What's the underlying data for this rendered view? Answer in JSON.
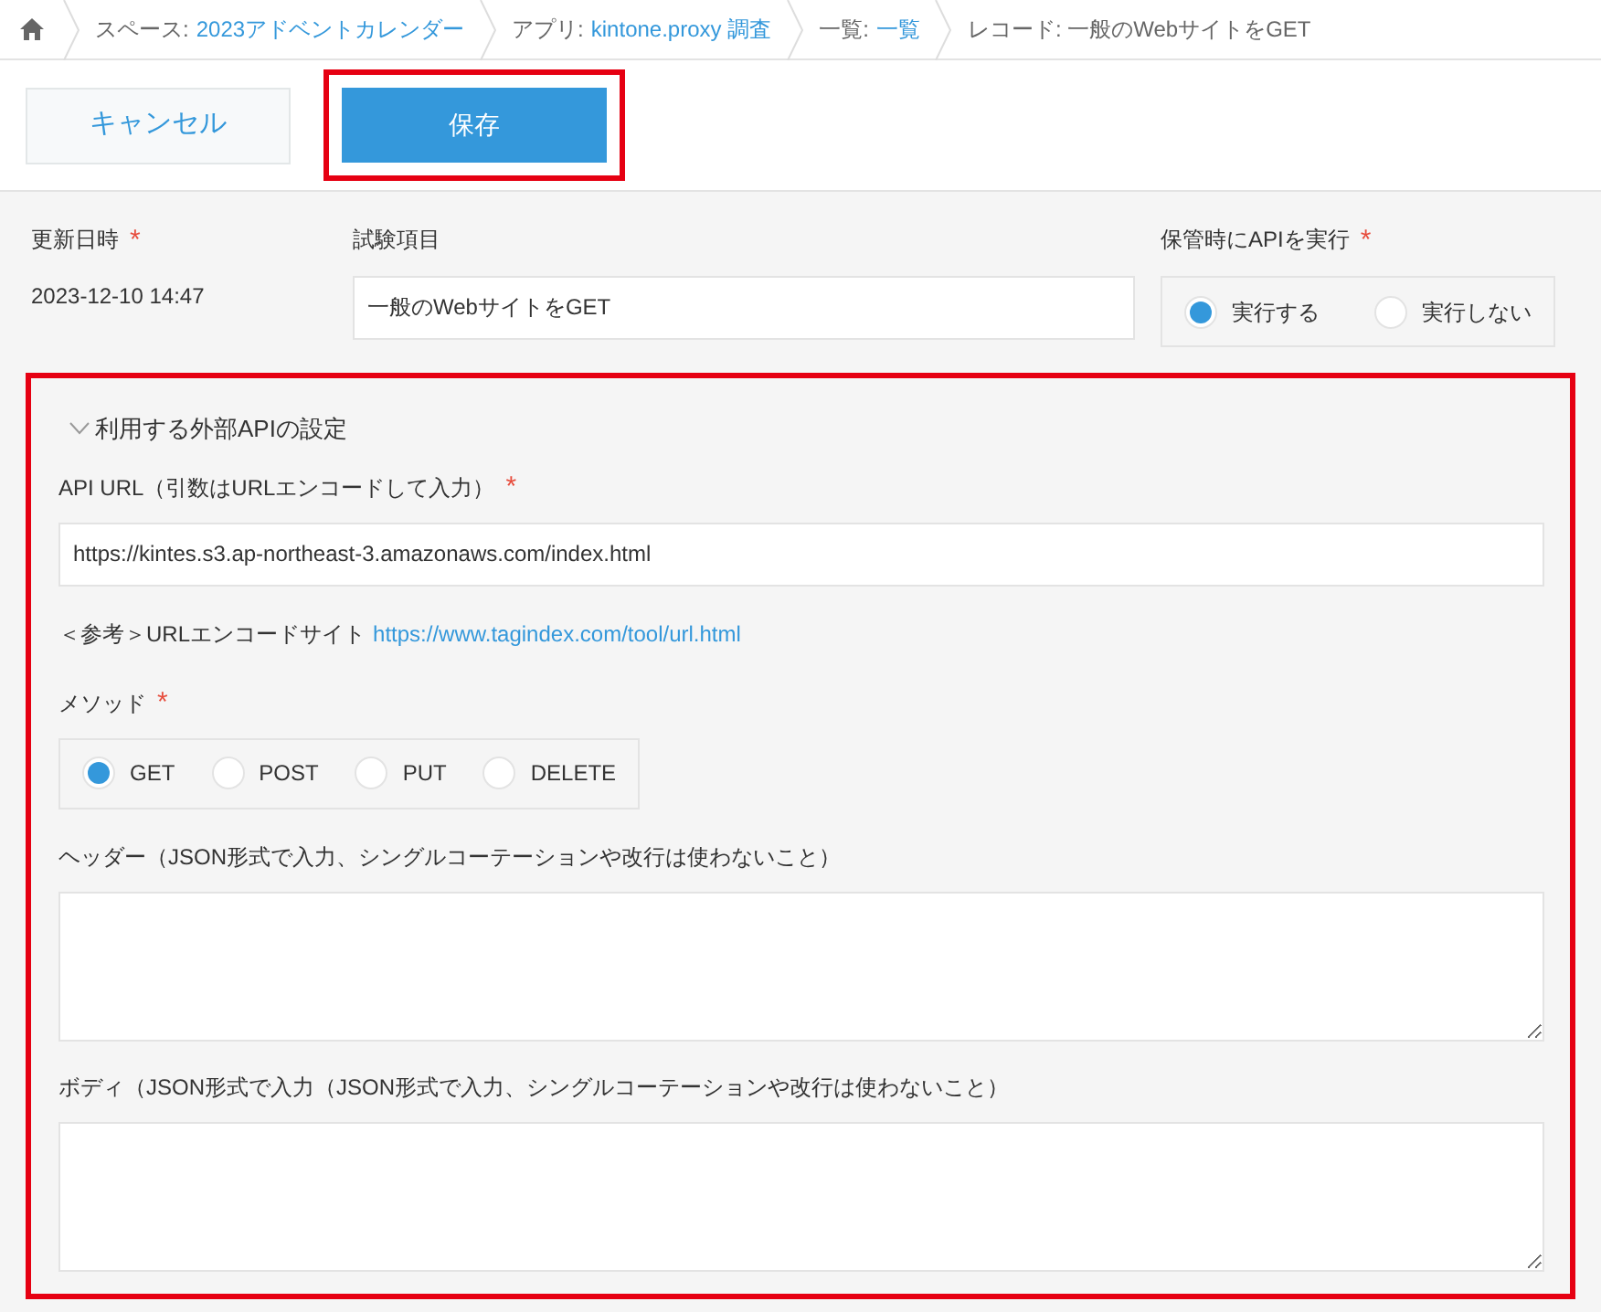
{
  "breadcrumb": [
    {
      "prefix": "スペース:",
      "link": "2023アドベントカレンダー"
    },
    {
      "prefix": "アプリ:",
      "link": "kintone.proxy 調査"
    },
    {
      "prefix": "一覧:",
      "link": "一覧"
    },
    {
      "prefix": "レコード: 一般のWebサイトをGET"
    }
  ],
  "toolbar": {
    "cancel": {
      "label": "キャンセル",
      "highlighted": false
    },
    "save": {
      "label": "保存",
      "highlighted": true
    }
  },
  "fields": [
    {
      "kind": "text",
      "label": "更新日時",
      "required_mark": "*",
      "value": "2023-12-10 14:47"
    },
    {
      "kind": "input",
      "label": "試験項目",
      "value": "一般のWebサイトをGET"
    },
    {
      "kind": "radio",
      "label": "保管時にAPIを実行",
      "required_mark": "*",
      "options": [
        {
          "label": "実行する",
          "selected": true
        },
        {
          "label": "実行しない",
          "selected": false
        }
      ]
    }
  ],
  "group": {
    "title": "利用する外部APIの設定",
    "expanded": true,
    "highlighted": true,
    "fields": [
      {
        "kind": "input",
        "label": "API URL（引数はURLエンコードして入力）",
        "required_mark": "*",
        "value": "https://kintes.s3.ap-northeast-3.amazonaws.com/index.html"
      },
      {
        "kind": "note",
        "text": "＜参考＞URLエンコードサイト",
        "link": "https://www.tagindex.com/tool/url.html"
      },
      {
        "kind": "radio",
        "label": "メソッド",
        "required_mark": "*",
        "options": [
          {
            "label": "GET",
            "selected": true
          },
          {
            "label": "POST",
            "selected": false
          },
          {
            "label": "PUT",
            "selected": false
          },
          {
            "label": "DELETE",
            "selected": false
          }
        ]
      },
      {
        "kind": "textarea",
        "label": "ヘッダー（JSON形式で入力、シングルコーテーションや改行は使わないこと）"
      },
      {
        "kind": "textarea",
        "label": "ボディ（JSON形式で入力（JSON形式で入力、シングルコーテーションや改行は使わないこと）"
      }
    ]
  }
}
